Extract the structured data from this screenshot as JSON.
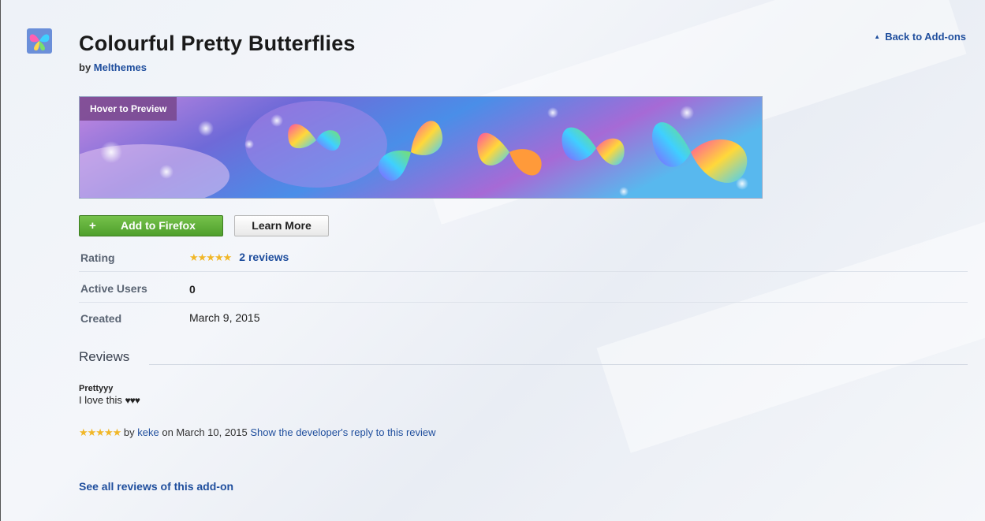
{
  "addon": {
    "title": "Colourful Pretty Butterflies",
    "by_prefix": "by",
    "author": "Melthemes",
    "icon": "butterfly-thumbnail-icon"
  },
  "nav": {
    "back_label": "Back to Add-ons",
    "back_icon": "triangle-up-icon"
  },
  "preview": {
    "hover_label": "Hover to Preview"
  },
  "buttons": {
    "add_icon": "plus-icon",
    "add_label": "Add to Firefox",
    "learn_label": "Learn More"
  },
  "meta": {
    "rating_label": "Rating",
    "rating_stars": 5,
    "rating_reviews": "2 reviews",
    "users_label": "Active Users",
    "users_value": "0",
    "created_label": "Created",
    "created_value": "March 9, 2015"
  },
  "reviews": {
    "heading": "Reviews",
    "items": [
      {
        "title": "Prettyyy",
        "body": "I love this",
        "body_hearts": "♥♥♥",
        "stars": 5,
        "by_prefix": "by",
        "author": "keke",
        "date_text": "on March 10, 2015",
        "reply_link": "Show the developer's reply to this review"
      }
    ],
    "see_all": "See all reviews of this add-on"
  },
  "colors": {
    "link": "#1f4e9d",
    "add_button": "#5aa935",
    "star": "#f1b727"
  }
}
